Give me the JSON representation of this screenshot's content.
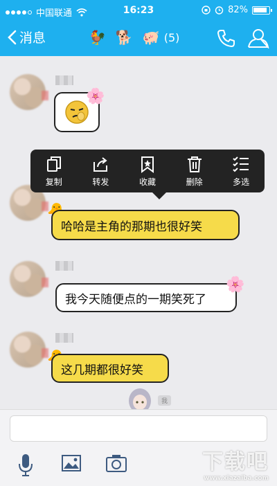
{
  "status": {
    "carrier": "中国联通",
    "time": "16:23",
    "battery": "82%"
  },
  "nav": {
    "back_label": "消息",
    "group_count": "(5)"
  },
  "chat": {
    "msg1": "哈哈是主角的那期也很好笑",
    "msg2": "我今天随便点的一期笑死了",
    "msg3": "这几期都很好笑",
    "my_nick": "我"
  },
  "menu": {
    "items": [
      {
        "label": "复制",
        "icon": "copy-icon"
      },
      {
        "label": "转发",
        "icon": "forward-icon"
      },
      {
        "label": "收藏",
        "icon": "bookmark-icon"
      },
      {
        "label": "删除",
        "icon": "trash-icon"
      },
      {
        "label": "多选",
        "icon": "multiselect-icon"
      }
    ]
  },
  "watermark": {
    "main": "下载吧",
    "url": "www.xiazaiba.com"
  },
  "colors": {
    "topbar": "#1eb0ef",
    "bubble_yellow": "#f6db4a",
    "menu_bg": "#232323"
  }
}
